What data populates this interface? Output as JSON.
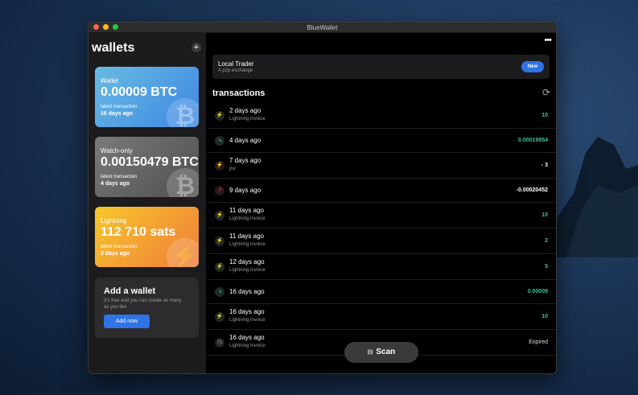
{
  "window": {
    "title": "BlueWallet"
  },
  "sidebar": {
    "title": "wallets",
    "add_symbol": "+",
    "wallets": [
      {
        "label": "Wallet",
        "balance": "0.00009 BTC",
        "lt_label": "latest transaction",
        "lt_value": "16 days ago"
      },
      {
        "label": "Watch-only",
        "balance": "0.00150479 BTC",
        "lt_label": "latest transaction",
        "lt_value": "4 days ago"
      },
      {
        "label": "Lightning",
        "balance": "112 710 sats",
        "lt_label": "latest transaction",
        "lt_value": "2 days ago"
      }
    ],
    "add_wallet": {
      "title": "Add a wallet",
      "text": "It's free and you can create as many as you like",
      "button": "Add now"
    }
  },
  "main": {
    "more_symbol": "•••",
    "banner": {
      "title": "Local Trader",
      "subtitle": "A p2p exchange",
      "badge": "New"
    },
    "transactions_title": "transactions",
    "transactions": [
      {
        "date": "2 days ago",
        "sub": "Lightning invoice",
        "amount": "10",
        "icon": "lightning-icon",
        "kind": "pos"
      },
      {
        "date": "4 days ago",
        "sub": "",
        "amount": "0.00019854",
        "icon": "incoming-arrow-icon",
        "kind": "pos"
      },
      {
        "date": "7 days ago",
        "sub": "pw",
        "amount": "- 3",
        "icon": "lightning-icon",
        "kind": "neg"
      },
      {
        "date": "9 days ago",
        "sub": "",
        "amount": "-0.00020452",
        "icon": "outgoing-arrow-icon",
        "kind": "neg"
      },
      {
        "date": "11 days ago",
        "sub": "Lightning invoice",
        "amount": "10",
        "icon": "lightning-icon",
        "kind": "pos"
      },
      {
        "date": "11 days ago",
        "sub": "Lightning invoice",
        "amount": "2",
        "icon": "lightning-icon",
        "kind": "pos"
      },
      {
        "date": "12 days ago",
        "sub": "Lightning invoice",
        "amount": "5",
        "icon": "lightning-icon",
        "kind": "pos"
      },
      {
        "date": "16 days ago",
        "sub": "",
        "amount": "0.00009",
        "icon": "incoming-arrow-icon",
        "kind": "pos"
      },
      {
        "date": "16 days ago",
        "sub": "Lightning invoice",
        "amount": "10",
        "icon": "lightning-icon",
        "kind": "pos"
      },
      {
        "date": "16 days ago",
        "sub": "Lightning invoice",
        "amount": "Expired",
        "icon": "clock-icon",
        "kind": "exp"
      }
    ],
    "scan_label": "Scan"
  },
  "colors": {
    "accent": "#2f73e6",
    "positive": "#37c0a1",
    "negative": "#d8453a"
  }
}
